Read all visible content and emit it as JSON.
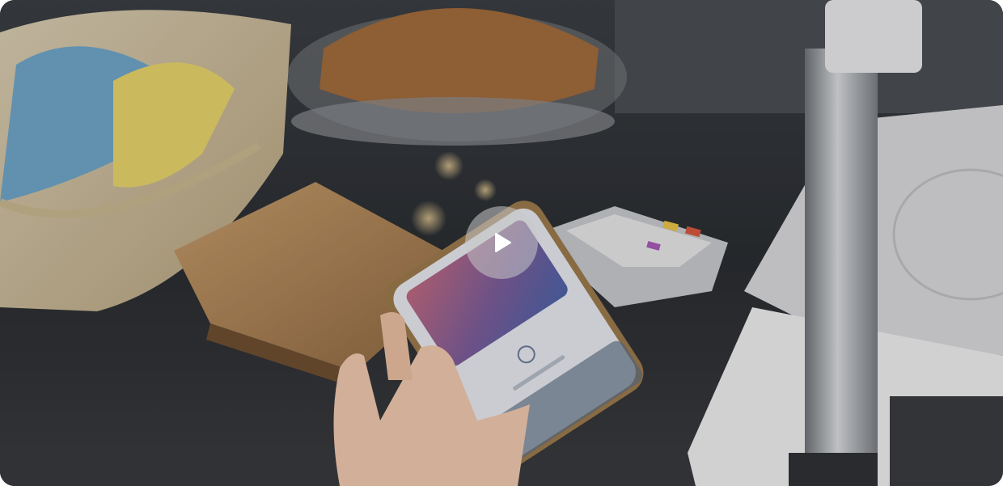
{
  "video": {
    "play_icon": "play-icon",
    "overlay_color": "#c8c8c8"
  }
}
